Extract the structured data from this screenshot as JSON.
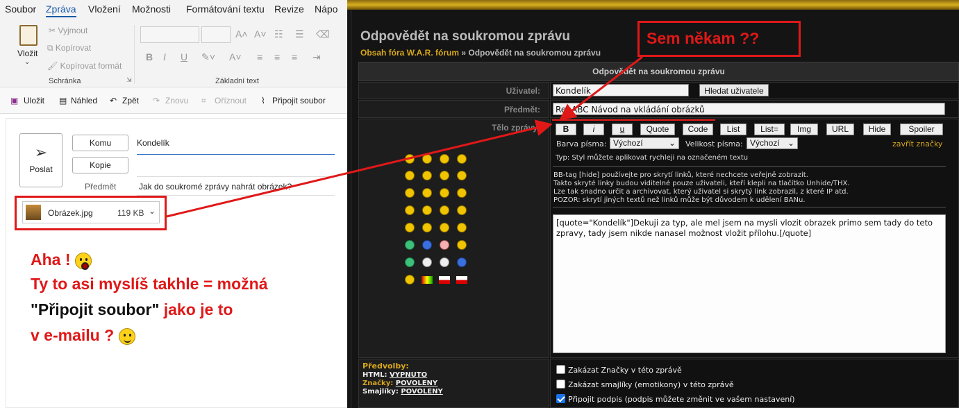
{
  "outlook": {
    "menu": [
      "Soubor",
      "Zpráva",
      "Vložení",
      "Možnosti",
      "Formátování textu",
      "Revize",
      "Nápo"
    ],
    "clipboard": {
      "paste": "Vložit",
      "cut": "Vyjmout",
      "copy": "Kopírovat",
      "format": "Kopírovat formát",
      "group": "Schránka"
    },
    "font_group": "Základní text",
    "quick": [
      "Uložit",
      "Náhled",
      "Zpět",
      "Znovu",
      "Oříznout",
      "Připojit soubor"
    ],
    "send": "Poslat",
    "to_btn": "Komu",
    "to_val": "Kondelík",
    "cc_btn": "Kopie",
    "subject_label": "Předmět",
    "subject_val": "Jak do soukromé zprávy nahrát obrázek?",
    "attachment": {
      "name": "Obrázek.jpg",
      "size": "119 KB"
    }
  },
  "annotation": {
    "line1": "Aha !",
    "line2": "Ty to asi myslíš takhle = možná",
    "line3_black": "\"Připojit soubor\"",
    "line3_red": " jako je to",
    "line4": "v e-mailu ?",
    "callout": "Sem někam ??"
  },
  "forum": {
    "title": "Odpovědět na soukromou zprávu",
    "breadcrumb_home": "Obsah fóra W.A.R. fórum",
    "breadcrumb_sep": " » ",
    "breadcrumb_current": "Odpovědět na soukromou zprávu",
    "header": "Odpovědět na soukromou zprávu",
    "user_label": "Uživatel:",
    "user_val": "Kondelík",
    "find_user": "Hledat uživatele",
    "subject_label": "Předmět:",
    "subject_val": "Re: ABC Návod na vkládání obrázků",
    "body_label": "Tělo zprávy:",
    "tags": [
      "B",
      "i",
      "u",
      "Quote",
      "Code",
      "List",
      "List=",
      "Img",
      "URL",
      "Hide",
      "Spoiler"
    ],
    "font_color_label": "Barva písma:",
    "font_color_val": "Výchozí",
    "font_size_label": "Velikost písma:",
    "font_size_val": "Výchozí",
    "close_tags": "zavřít značky",
    "tip": "Typ: Styl můžete aplikovat rychleji na označeném textu",
    "info1": "BB-tag [hide] používejte pro skrytí linků, které nechcete veřejně zobrazit.",
    "info2": "Takto skryté linky budou viditelné pouze uživateli, kteří klepli na tlačítko Unhide/THX.",
    "info3": "Lze tak snadno určit a archivovat, který uživatel si skrytý link zobrazil, z které IP atd.",
    "info4": "POZOR: skrytí jiných textů než linků může být důvodem k udělení BANu.",
    "message": "[quote=\"Kondelík\"]Dekuji za typ, ale mel jsem na mysli vlozit obrazek primo sem tady do teto zpravy,  tady jsem nikde nanasel možnost vložit přílohu.[/quote]",
    "prefs_title": "Předvolby:",
    "prefs": [
      {
        "k": "HTML:",
        "v": "VYPNUTO"
      },
      {
        "k": "Značky:",
        "v": "POVOLENY"
      },
      {
        "k": "Smajlíky:",
        "v": "POVOLENY"
      }
    ],
    "options": [
      {
        "label": "Zakázat Značky v této zprávě",
        "checked": false
      },
      {
        "label": "Zakázat smajlíky (emotikony) v této zprávě",
        "checked": false
      },
      {
        "label": "Připojit podpis (podpis můžete změnit ve vašem nastavení)",
        "checked": true
      }
    ]
  },
  "colors": {
    "accent_red": "#e01818",
    "forum_gold": "#d7a71c"
  }
}
